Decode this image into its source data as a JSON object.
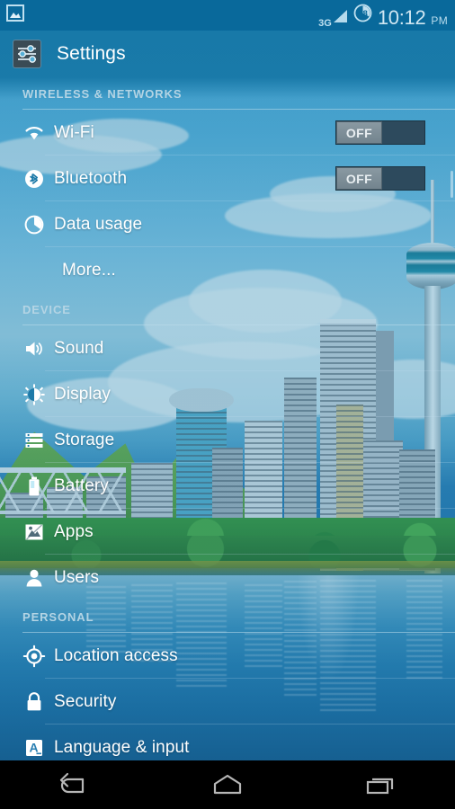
{
  "statusbar": {
    "notification_icon": "photo-icon",
    "network_type": "3G",
    "signal_icon": "signal-bars-icon",
    "battery_level": "48",
    "battery_icon": "battery-circle-icon",
    "time": "10:12",
    "meridiem": "PM"
  },
  "header": {
    "icon": "settings-sliders-icon",
    "title": "Settings"
  },
  "sections": [
    {
      "title": "WIRELESS & NETWORKS",
      "rows": [
        {
          "label": "Wi-Fi",
          "icon": "wifi-icon",
          "toggle": "OFF"
        },
        {
          "label": "Bluetooth",
          "icon": "bluetooth-icon",
          "toggle": "OFF"
        },
        {
          "label": "Data usage",
          "icon": "pie-chart-icon"
        },
        {
          "label": "More...",
          "icon": null
        }
      ]
    },
    {
      "title": "DEVICE",
      "rows": [
        {
          "label": "Sound",
          "icon": "speaker-icon"
        },
        {
          "label": "Display",
          "icon": "brightness-icon"
        },
        {
          "label": "Storage",
          "icon": "storage-bars-icon"
        },
        {
          "label": "Battery",
          "icon": "battery-icon"
        },
        {
          "label": "Apps",
          "icon": "apps-image-icon"
        },
        {
          "label": "Users",
          "icon": "person-icon"
        }
      ]
    },
    {
      "title": "PERSONAL",
      "rows": [
        {
          "label": "Location access",
          "icon": "location-crosshair-icon"
        },
        {
          "label": "Security",
          "icon": "lock-icon"
        },
        {
          "label": "Language & input",
          "icon": "language-a-icon"
        }
      ]
    }
  ],
  "navbar": {
    "back": "back-icon",
    "home": "home-icon",
    "recents": "recents-icon"
  },
  "colors": {
    "tint_blue": "#0a6c9c",
    "statusbar_blue": "#09699b",
    "accent_text": "#ffffff",
    "section_header": "#b4d4e4",
    "toggle_track": "#2d4a5d",
    "toggle_thumb": "#7d8d96",
    "navbar": "#000000"
  }
}
